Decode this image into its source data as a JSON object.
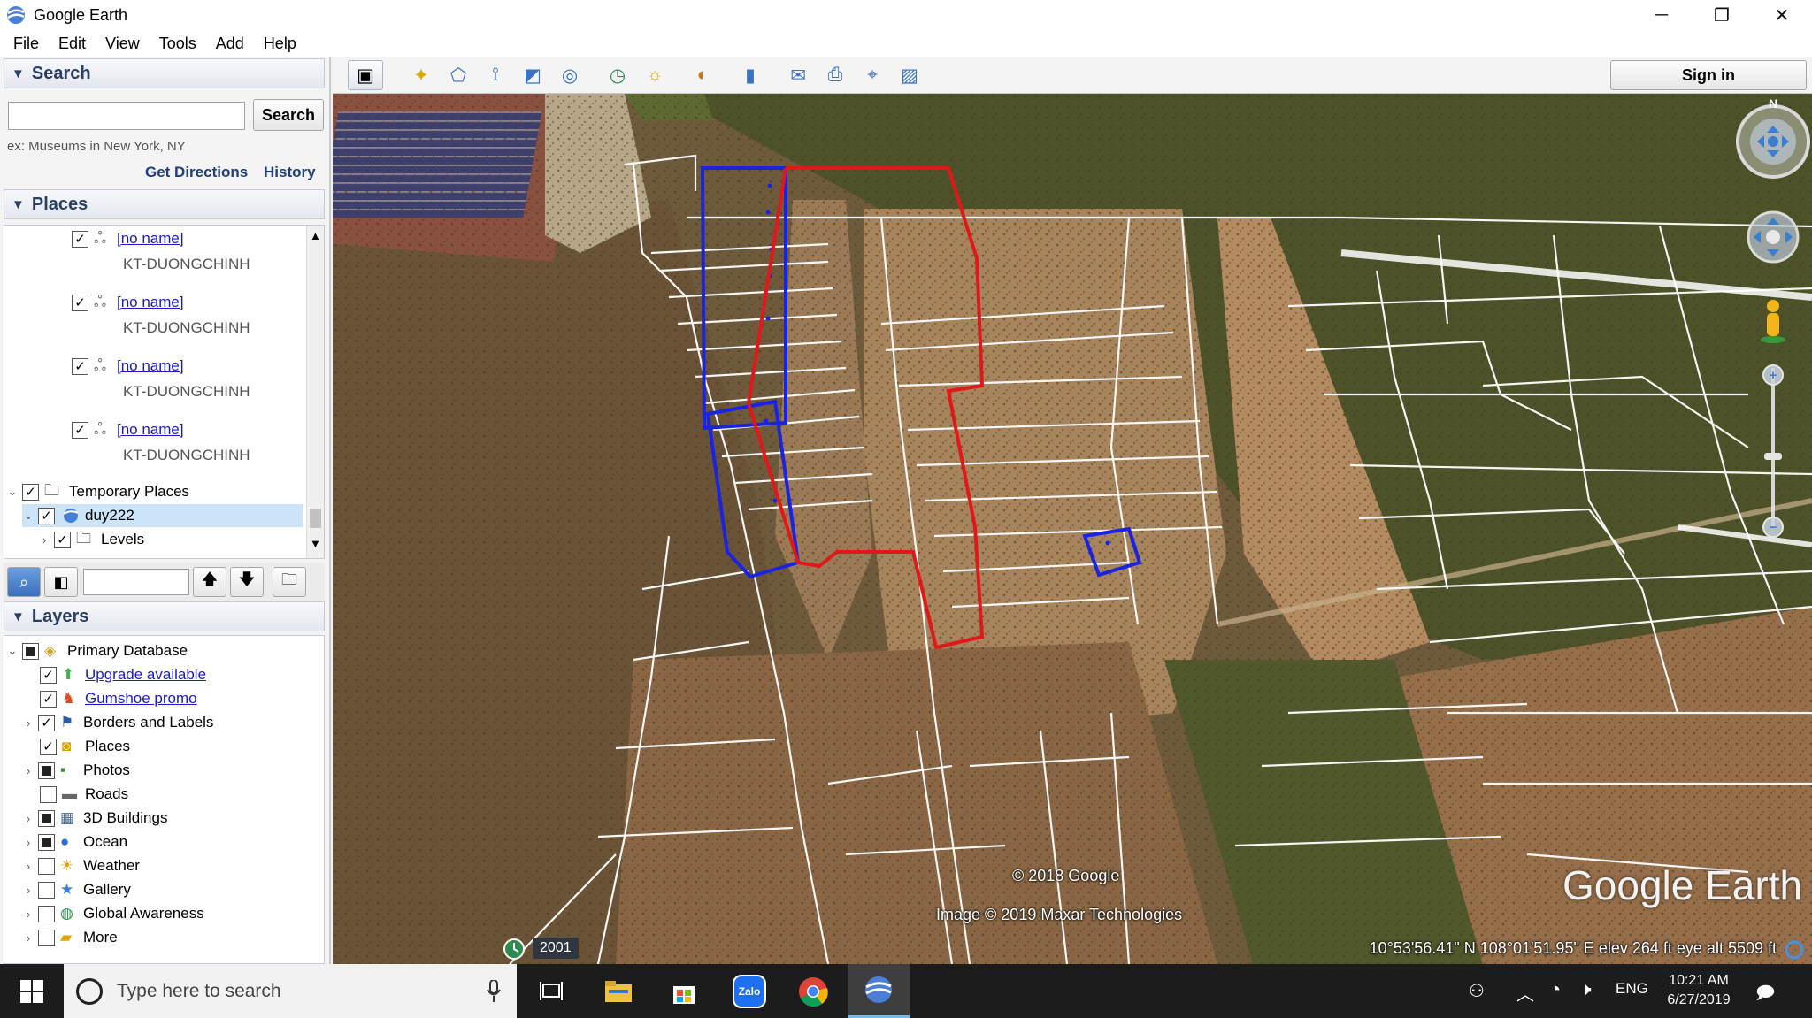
{
  "window": {
    "title": "Google Earth",
    "minimize": "─",
    "restore": "❐",
    "close": "✕"
  },
  "menu": [
    "File",
    "Edit",
    "View",
    "Tools",
    "Add",
    "Help"
  ],
  "search": {
    "header": "Search",
    "button": "Search",
    "hint": "ex: Museums in New York, NY",
    "get_directions": "Get Directions",
    "history": "History"
  },
  "places": {
    "header": "Places",
    "items": [
      {
        "name": "[no name]",
        "sub": "KT-DUONGCHINH"
      },
      {
        "name": "[no name]",
        "sub": "KT-DUONGCHINH"
      },
      {
        "name": "[no name]",
        "sub": "KT-DUONGCHINH"
      },
      {
        "name": "[no name]",
        "sub": "KT-DUONGCHINH"
      }
    ],
    "temporary": "Temporary Places",
    "file": "duy222",
    "levels": "Levels"
  },
  "layers": {
    "header": "Layers",
    "items": [
      {
        "label": "Primary Database",
        "link": false
      },
      {
        "label": "Upgrade available",
        "link": true
      },
      {
        "label": "Gumshoe promo",
        "link": true
      },
      {
        "label": "Borders and Labels",
        "link": false
      },
      {
        "label": "Places",
        "link": false
      },
      {
        "label": "Photos",
        "link": false
      },
      {
        "label": "Roads",
        "link": false
      },
      {
        "label": "3D Buildings",
        "link": false
      },
      {
        "label": "Ocean",
        "link": false
      },
      {
        "label": "Weather",
        "link": false
      },
      {
        "label": "Gallery",
        "link": false
      },
      {
        "label": "Global Awareness",
        "link": false
      },
      {
        "label": "More",
        "link": false
      }
    ]
  },
  "toolbar": {
    "sign_in": "Sign in"
  },
  "map": {
    "copyright_google": "© 2018 Google",
    "copyright_imagery": "Image © 2019 Maxar Technologies",
    "logo": "Google Earth",
    "year": "2001",
    "coords": "10°53'56.41\" N  108°01'51.95\" E  elev  264 ft     eye alt  5509 ft",
    "compass_n": "N"
  },
  "taskbar": {
    "search_placeholder": "Type here to search",
    "lang": "ENG",
    "time": "10:21 AM",
    "date": "6/27/2019",
    "zalo": "Zalo"
  },
  "colors": {
    "outline_red": "#e0181a",
    "outline_blue": "#1a24e0",
    "parcel_white": "#ffffff"
  }
}
